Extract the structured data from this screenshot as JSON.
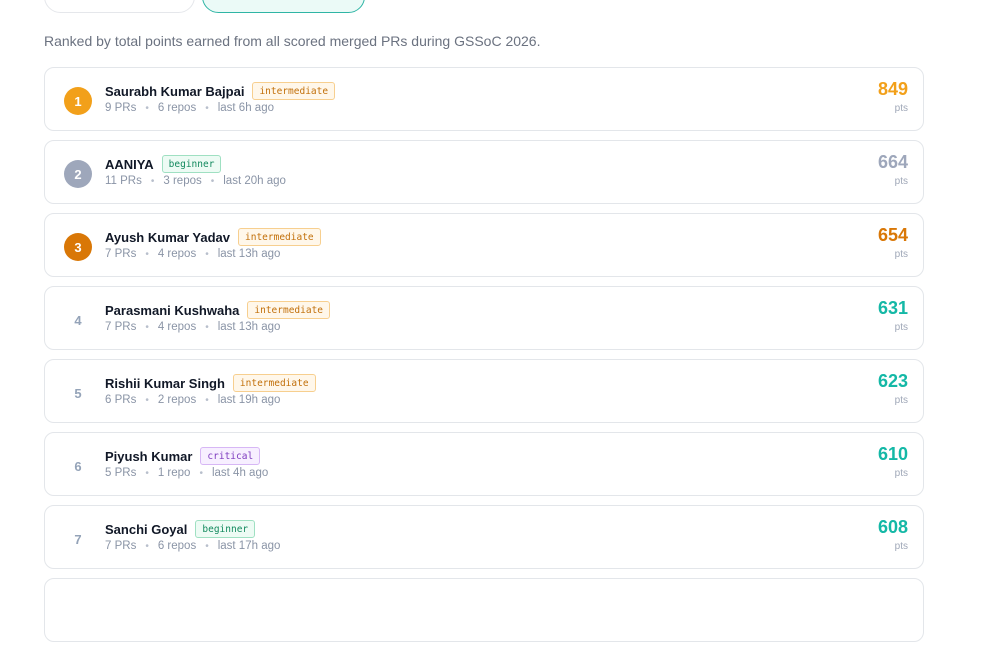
{
  "subtitle": "Ranked by total points earned from all scored merged PRs during GSSoC 2026.",
  "pts_label": "pts",
  "colors": {
    "gold": "#f2a01a",
    "silver": "#9ea7bb",
    "bronze": "#d97706",
    "teal": "#14b8a6"
  },
  "rows": [
    {
      "rank": "1",
      "name": "Saurabh Kumar Bajpai",
      "badge": "intermediate",
      "prs": "9 PRs",
      "repos": "6 repos",
      "last": "last 6h ago",
      "points": "849"
    },
    {
      "rank": "2",
      "name": "AANIYA",
      "badge": "beginner",
      "prs": "11 PRs",
      "repos": "3 repos",
      "last": "last 20h ago",
      "points": "664"
    },
    {
      "rank": "3",
      "name": "Ayush Kumar Yadav",
      "badge": "intermediate",
      "prs": "7 PRs",
      "repos": "4 repos",
      "last": "last 13h ago",
      "points": "654"
    },
    {
      "rank": "4",
      "name": "Parasmani Kushwaha",
      "badge": "intermediate",
      "prs": "7 PRs",
      "repos": "4 repos",
      "last": "last 13h ago",
      "points": "631"
    },
    {
      "rank": "5",
      "name": "Rishii Kumar Singh",
      "badge": "intermediate",
      "prs": "6 PRs",
      "repos": "2 repos",
      "last": "last 19h ago",
      "points": "623"
    },
    {
      "rank": "6",
      "name": "Piyush Kumar",
      "badge": "critical",
      "prs": "5 PRs",
      "repos": "1 repo",
      "last": "last 4h ago",
      "points": "610"
    },
    {
      "rank": "7",
      "name": "Sanchi Goyal",
      "badge": "beginner",
      "prs": "7 PRs",
      "repos": "6 repos",
      "last": "last 17h ago",
      "points": "608"
    }
  ]
}
